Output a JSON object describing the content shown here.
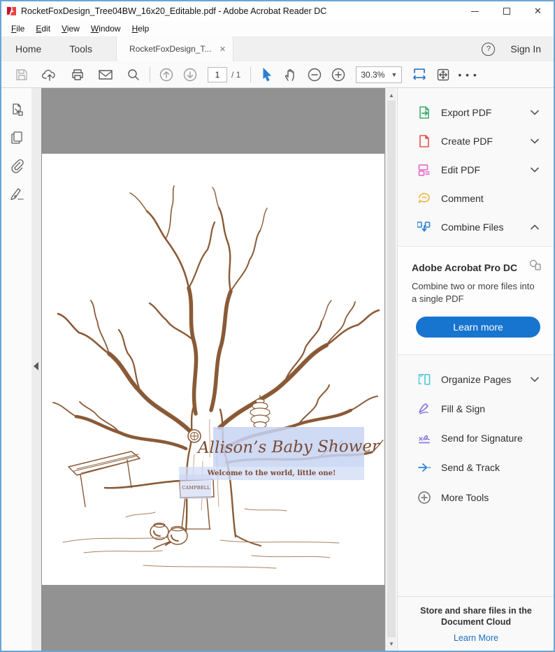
{
  "window": {
    "title": "RocketFoxDesign_Tree04BW_16x20_Editable.pdf - Adobe Acrobat Reader DC",
    "close_glyph": "✕"
  },
  "menu": {
    "items": [
      {
        "key": "F",
        "rest": "ile"
      },
      {
        "key": "E",
        "rest": "dit"
      },
      {
        "key": "V",
        "rest": "iew"
      },
      {
        "key": "W",
        "rest": "indow"
      },
      {
        "key": "H",
        "rest": "elp"
      }
    ]
  },
  "tab_bar": {
    "home": "Home",
    "tools": "Tools",
    "document_tab": "RocketFoxDesign_T...",
    "close_glyph": "✕",
    "help_glyph": "?",
    "sign_in": "Sign In"
  },
  "toolbar": {
    "page_current": "1",
    "page_total": "/ 1",
    "zoom_level": "30.3%",
    "caret_glyph": "▼",
    "more_glyph": "• • •"
  },
  "scrollbar": {
    "up_glyph": "▲",
    "down_glyph": "▼"
  },
  "document": {
    "fields": {
      "title": "Allison’s Baby Shower",
      "subtitle": "Welcome to the world, little one!",
      "sign_name": "CAMPBELL"
    },
    "colors": {
      "field_highlight": "#ccd9f5",
      "ink": "#8a5a36"
    }
  },
  "right_panel": {
    "tools_top": [
      {
        "label": "Export PDF"
      },
      {
        "label": "Create PDF"
      },
      {
        "label": "Edit PDF"
      },
      {
        "label": "Comment"
      },
      {
        "label": "Combine Files"
      }
    ],
    "promo": {
      "title": "Adobe Acrobat Pro DC",
      "body": "Combine two or more files into a single PDF",
      "button": "Learn more"
    },
    "tools_bottom": [
      {
        "label": "Organize Pages"
      },
      {
        "label": "Fill & Sign"
      },
      {
        "label": "Send for Signature"
      },
      {
        "label": "Send & Track"
      },
      {
        "label": "More Tools"
      }
    ],
    "footer": {
      "message": "Store and share files in the Document Cloud",
      "link": "Learn More"
    }
  },
  "colors": {
    "accent_blue": "#1774cf",
    "panel_green": "#3fae68",
    "panel_red": "#e5544d",
    "panel_magenta": "#e561c8",
    "panel_yellow": "#efb73e",
    "panel_blue": "#2d83d8",
    "panel_cyan": "#45c5e0",
    "panel_purple": "#8577e6",
    "window_border": "#6aa6d5"
  }
}
